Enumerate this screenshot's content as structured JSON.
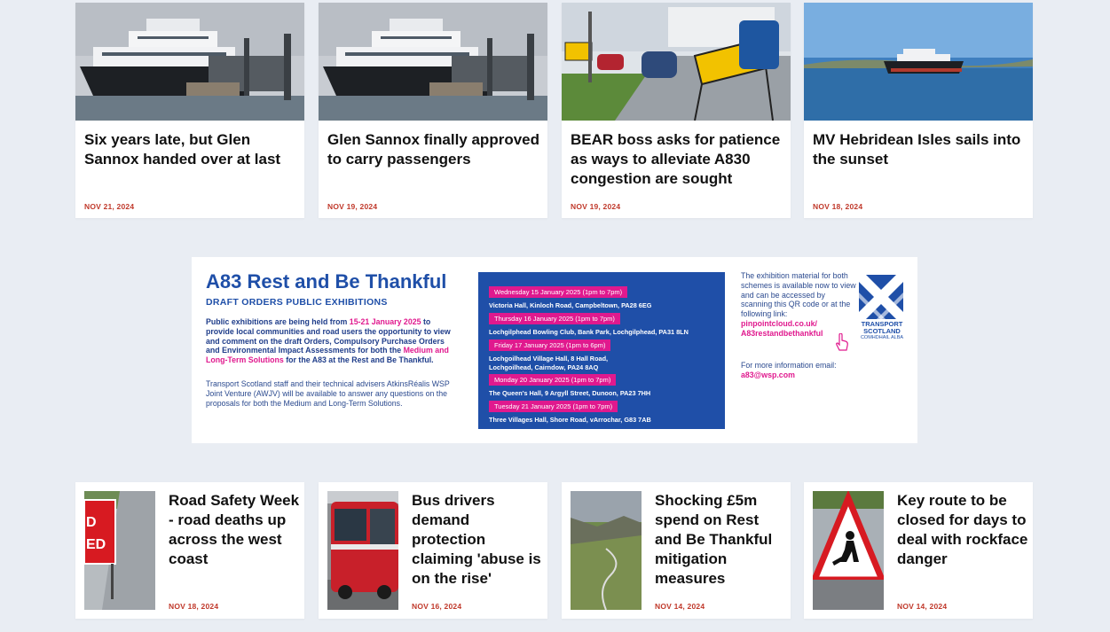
{
  "top_articles": [
    {
      "title": "Six years late, but Glen Sannox handed over at last",
      "date": "NOV 21, 2024",
      "image": "ferry-at-pier"
    },
    {
      "title": "Glen Sannox finally approved to carry passengers",
      "date": "NOV 19, 2024",
      "image": "ferry-at-pier"
    },
    {
      "title": "BEAR boss asks for patience as ways to alleviate A830 congestion are sought",
      "date": "NOV 19, 2024",
      "image": "road-caution-sign"
    },
    {
      "title": "MV Hebridean Isles sails into the sunset",
      "date": "NOV 18, 2024",
      "image": "ferry-at-sea"
    }
  ],
  "banner": {
    "title": "A83 Rest and Be Thankful",
    "subtitle": "DRAFT ORDERS PUBLIC EXHIBITIONS",
    "para1_a": "Public exhibitions are being held from ",
    "para1_dates": "15-21 January 2025",
    "para1_b": " to provide local communities and road users the opportunity to view and comment on the draft Orders, Compulsory Purchase Orders and Environmental Impact Assessments for both the ",
    "para1_schemes": "Medium and Long-Term Solutions",
    "para1_c": " for the A83 at the Rest and Be Thankful.",
    "para2": "Transport Scotland staff and their technical advisers AtkinsRéalis WSP Joint Venture (AWJV) will be available to answer any questions on the proposals for both the Medium and Long-Term Solutions.",
    "schedule": [
      {
        "date": "Wednesday 15 January 2025 (1pm to 7pm)",
        "venue": "Victoria Hall, Kinloch Road, Campbeltown, PA28 6EG"
      },
      {
        "date": "Thursday 16 January 2025 (1pm to 7pm)",
        "venue": "Lochgilphead Bowling Club, Bank Park, Lochgilphead, PA31 8LN"
      },
      {
        "date": "Friday 17 January 2025 (1pm to 6pm)",
        "venue": "Lochgoilhead Village Hall, 8 Hall Road,",
        "venue2": "Lochgoilhead, Cairndow, PA24 8AQ"
      },
      {
        "date": "Monday 20 January 2025 (1pm to 7pm)",
        "venue": "The Queen's Hall, 9 Argyll Street, Dunoon, PA23 7HH"
      },
      {
        "date": "Tuesday 21 January 2025 (1pm to 7pm)",
        "venue": "Three Villages Hall, Shore Road, vArrochar, G83 7AB"
      }
    ],
    "right_text": "The exhibition material for both schemes is available now to view and can be accessed by scanning this QR code or at the following link:",
    "link": "pinpointcloud.co.uk/ A83restandbethankful",
    "more_info": "For more information email:",
    "email": "a83@wsp.com",
    "logo_line1": "TRANSPORT SCOTLAND",
    "logo_line2": "COMHDHAIL ALBA",
    "logo_icon": "saltire-logo"
  },
  "bottom_articles": [
    {
      "title": "Road Safety Week - road deaths up across the west coast",
      "date": "NOV 18, 2024",
      "image": "road-closed-sign"
    },
    {
      "title": "Bus drivers demand protection claiming 'abuse is on the rise'",
      "date": "NOV 16, 2024",
      "image": "red-bus"
    },
    {
      "title": "Shocking £5m spend on Rest and Be Thankful mitigation measures",
      "date": "NOV 14, 2024",
      "image": "glen-road"
    },
    {
      "title": "Key route to be closed for days to deal with rockface danger",
      "date": "NOV 14, 2024",
      "image": "roadworks-sign"
    }
  ]
}
